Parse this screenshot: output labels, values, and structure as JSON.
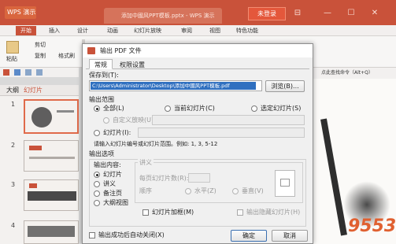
{
  "app": {
    "logo": "WPS 演示",
    "doc_tab": "添加中國风PPT模板.pptx - WPS 演示",
    "login": "未登录",
    "window_controls": [
      "⊟",
      "—",
      "☐",
      "✕"
    ]
  },
  "menu": [
    "开始",
    "插入",
    "设计",
    "动画",
    "幻灯片放映",
    "审阅",
    "视图",
    "特色功能"
  ],
  "ribbon": {
    "paste": "粘贴",
    "cut": "剪切",
    "copy": "复制",
    "format_painter": "格式刷",
    "new_slide": "新建幻灯片"
  },
  "right_strip_text": "点此查找命令（Alt+Q）",
  "panel_tabs": [
    "大纲",
    "幻灯片"
  ],
  "slide_numbers": [
    "1",
    "2",
    "3",
    "4"
  ],
  "watermark": "9553",
  "dialog": {
    "title": "输出 PDF 文件",
    "tabs": [
      "常规",
      "权限设置"
    ],
    "save_to_label": "保存到(T):",
    "save_path": "C:\\Users\\Administrator\\Desktop\\添加中國风PPT模板.pdf",
    "browse": "浏览(B)...",
    "range_label": "输出范围",
    "range_all": "全部(L)",
    "range_current": "当前幻灯片(C)",
    "range_selected": "选定幻灯片(S)",
    "range_custom": "自定义放映(U):",
    "range_slides": "幻灯片(I):",
    "range_hint": "请输入幻灯片编号或幻灯片范围。例如: 1, 3, 5-12",
    "options_label": "输出选项",
    "content_label": "输出内容:",
    "content_options": [
      "幻灯片",
      "讲义",
      "备注页",
      "大纲视图"
    ],
    "handout_label": "讲义",
    "per_page_label": "每页幻灯片数(R):",
    "order_label": "顺序",
    "order_horizontal": "水平(Z)",
    "order_vertical": "垂直(V)",
    "frame_label": "幻灯片加框(M)",
    "hidden_label": "输出隐藏幻灯片(H)",
    "close_after": "输出成功后自动关闭(X)",
    "ok": "确定",
    "cancel": "取消"
  }
}
